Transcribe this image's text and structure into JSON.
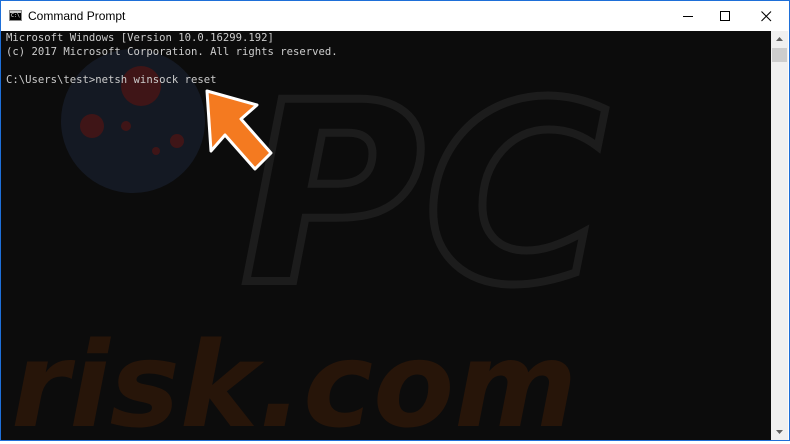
{
  "window": {
    "title": "Command Prompt",
    "icon": "cmd-icon",
    "icon_prompt": "C:\\",
    "controls": [
      "minimize-icon",
      "maximize-icon",
      "close-icon"
    ],
    "border_color": "#1e6fd8"
  },
  "console": {
    "background": "#0c0c0c",
    "text_color": "#cccccc",
    "lines": [
      "Microsoft Windows [Version 10.0.16299.192]",
      "(c) 2017 Microsoft Corporation. All rights reserved.",
      "",
      "C:\\Users\\test>netsh winsock reset"
    ]
  },
  "annotation": {
    "icon": "arrow-pointer-icon",
    "color": "#f47a20"
  },
  "watermark": {
    "text": "PC risk.com",
    "logo_text": "PC",
    "brand_text": "risk.com"
  }
}
